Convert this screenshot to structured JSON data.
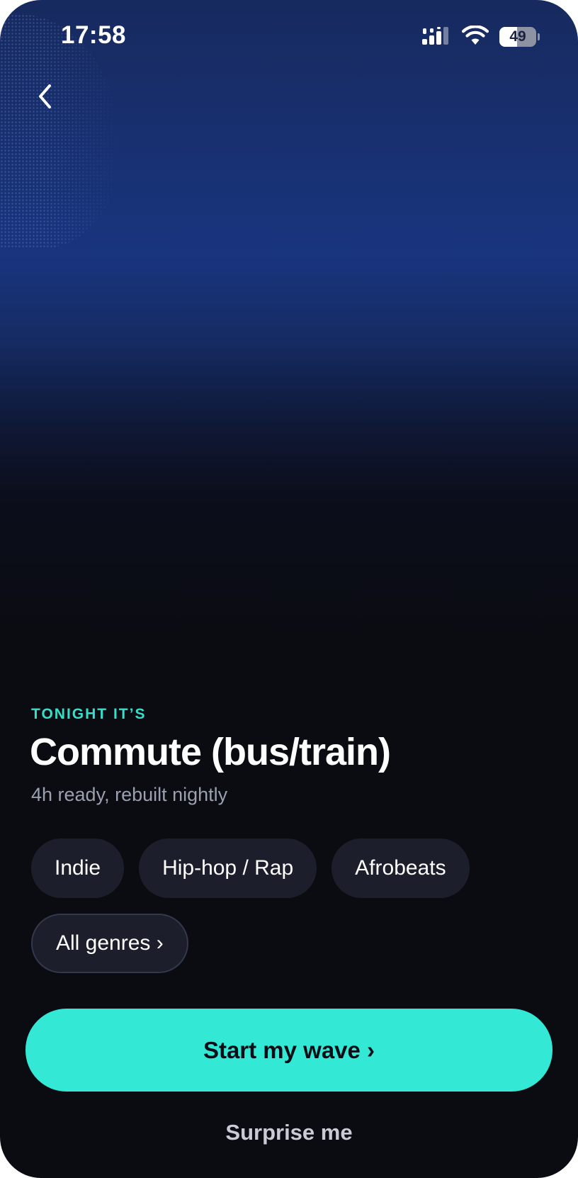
{
  "status_bar": {
    "time": "17:58",
    "battery_level": "49",
    "battery_fraction": 0.49,
    "icons": [
      "signal-icon",
      "wifi-icon",
      "battery-icon"
    ]
  },
  "nav": {
    "back_icon": "chevron-left-icon"
  },
  "content": {
    "eyebrow": "TONIGHT IT’S",
    "title": "Commute (bus/train)",
    "subtitle": "4h ready, rebuilt nightly",
    "genres": [
      "Indie",
      "Hip-hop / Rap",
      "Afrobeats"
    ],
    "all_genres_label": "All genres ›"
  },
  "actions": {
    "primary_label": "Start my wave ›",
    "secondary_label": "Surprise me"
  },
  "colors": {
    "accent": "#33e8d4",
    "eyebrow": "#35dfc9",
    "background_top": "#19357e",
    "background_bottom": "#0b0c12",
    "chip_background": "#1c1f2b"
  }
}
